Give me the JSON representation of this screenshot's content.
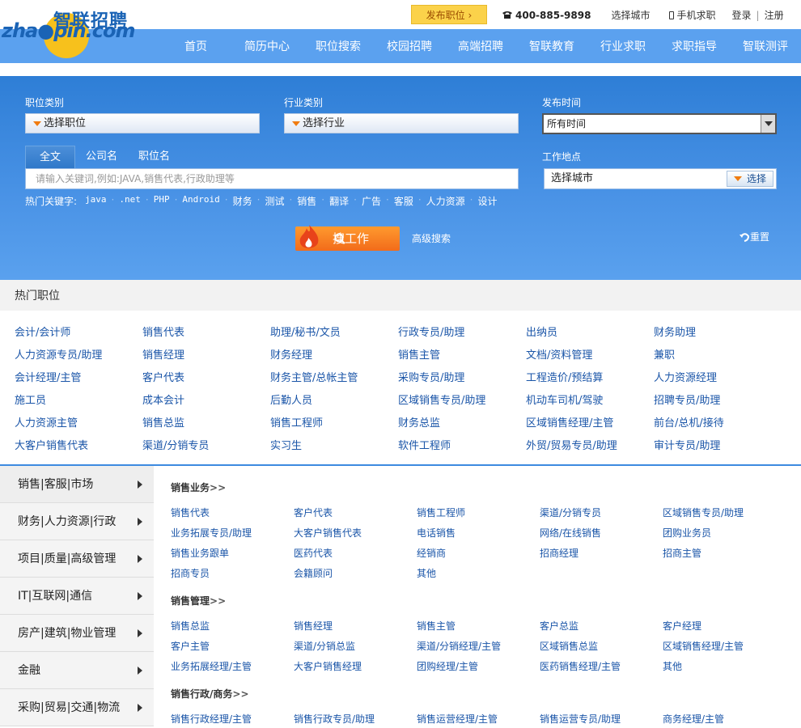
{
  "logo": {
    "en": "zha●pin.com",
    "cn": "智联招聘"
  },
  "topbar": {
    "post_job": "发布职位",
    "phone": "400-885-9898",
    "select_city": "选择城市",
    "mobile": "手机求职",
    "login": "登录",
    "register": "注册",
    "sep": "|"
  },
  "nav": [
    "首页",
    "简历中心",
    "职位搜索",
    "校园招聘",
    "高端招聘",
    "智联教育",
    "行业求职",
    "求职指导",
    "智联测评"
  ],
  "search": {
    "job_type_label": "职位类别",
    "job_type_value": "选择职位",
    "industry_label": "行业类别",
    "industry_value": "选择行业",
    "time_label": "发布时间",
    "time_value": "所有时间",
    "tabs": [
      "全文",
      "公司名",
      "职位名"
    ],
    "keyword_placeholder": "请输入关键词,例如:JAVA,销售代表,行政助理等",
    "location_label": "工作地点",
    "location_value": "选择城市",
    "location_button": "选择",
    "hot_label": "热门关键字:",
    "hot_keywords": [
      "java",
      ".net",
      "PHP",
      "Android",
      "财务",
      "测试",
      "销售",
      "翻译",
      "广告",
      "客服",
      "人力资源",
      "设计"
    ],
    "search_button": "搜工作",
    "advanced": "高级搜索",
    "reset": "重置"
  },
  "hot_jobs": {
    "title": "热门职位",
    "rows": [
      [
        "会计/会计师",
        "销售代表",
        "助理/秘书/文员",
        "行政专员/助理",
        "出纳员",
        "财务助理"
      ],
      [
        "人力资源专员/助理",
        "销售经理",
        "财务经理",
        "销售主管",
        "文档/资料管理",
        "兼职"
      ],
      [
        "会计经理/主管",
        "客户代表",
        "财务主管/总帐主管",
        "采购专员/助理",
        "工程造价/预结算",
        "人力资源经理"
      ],
      [
        "施工员",
        "成本会计",
        "后勤人员",
        "区域销售专员/助理",
        "机动车司机/驾驶",
        "招聘专员/助理"
      ],
      [
        "人力资源主管",
        "销售总监",
        "销售工程师",
        "财务总监",
        "区域销售经理/主管",
        "前台/总机/接待"
      ],
      [
        "大客户销售代表",
        "渠道/分销专员",
        "实习生",
        "软件工程师",
        "外贸/贸易专员/助理",
        "审计专员/助理"
      ]
    ]
  },
  "categories": {
    "side": [
      "销售|客服|市场",
      "财务|人力资源|行政",
      "项目|质量|高级管理",
      "IT|互联网|通信",
      "房产|建筑|物业管理",
      "金融",
      "采购|贸易|交通|物流"
    ],
    "groups": [
      {
        "title": "销售业务",
        "arrow": ">>",
        "items": [
          "销售代表",
          "客户代表",
          "销售工程师",
          "渠道/分销专员",
          "区域销售专员/助理",
          "业务拓展专员/助理",
          "大客户销售代表",
          "电话销售",
          "网络/在线销售",
          "团购业务员",
          "销售业务跟单",
          "医药代表",
          "经销商",
          "招商经理",
          "招商主管",
          "招商专员",
          "会籍顾问",
          "其他"
        ]
      },
      {
        "title": "销售管理",
        "arrow": ">>",
        "items": [
          "销售总监",
          "销售经理",
          "销售主管",
          "客户总监",
          "客户经理",
          "客户主管",
          "渠道/分销总监",
          "渠道/分销经理/主管",
          "区域销售总监",
          "区域销售经理/主管",
          "业务拓展经理/主管",
          "大客户销售经理",
          "团购经理/主管",
          "医药销售经理/主管",
          "其他"
        ]
      },
      {
        "title": "销售行政/商务",
        "arrow": ">>",
        "items": [
          "销售行政经理/主管",
          "销售行政专员/助理",
          "销售运营经理/主管",
          "销售运营专员/助理",
          "商务经理/主管"
        ]
      }
    ]
  }
}
